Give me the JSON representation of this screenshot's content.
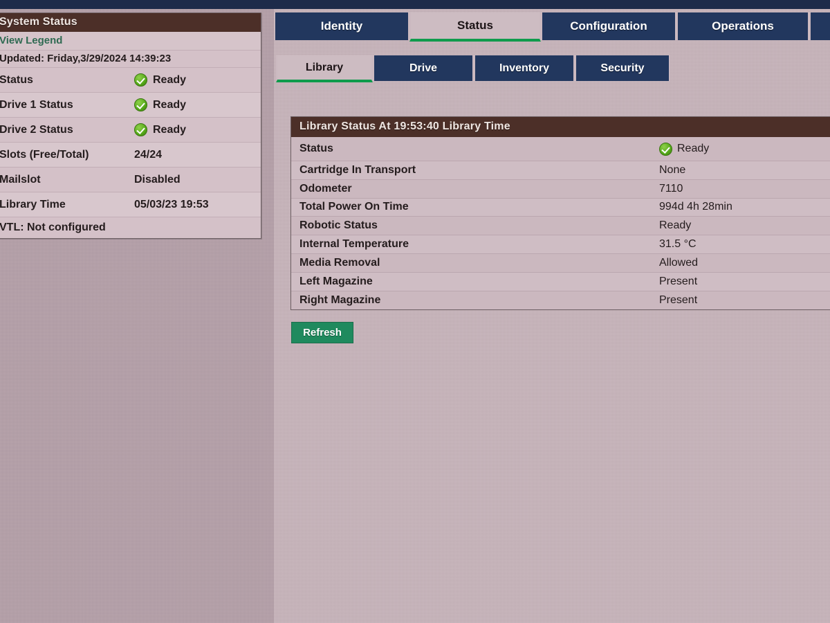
{
  "colors": {
    "navy_strip": "#1d2b4a",
    "tab_inactive": "#22375e",
    "tab_active_underline": "#0f9b4c",
    "panel_header": "#4c2f28",
    "refresh_button": "#1f8a5e",
    "link": "#2f6a52",
    "status_ok": "#55a818",
    "background_left": "#b6a0a9",
    "background_right": "#c7b3ba"
  },
  "sidebar": {
    "title": "System Status",
    "legend_link": "View Legend",
    "updated": "Updated: Friday,3/29/2024 14:39:23",
    "rows": [
      {
        "label": "Status",
        "value": "Ready",
        "icon": "status-ok-icon"
      },
      {
        "label": "Drive 1 Status",
        "value": "Ready",
        "icon": "status-ok-icon"
      },
      {
        "label": "Drive 2 Status",
        "value": "Ready",
        "icon": "status-ok-icon"
      },
      {
        "label": "Slots (Free/Total)",
        "value": "24/24",
        "icon": ""
      },
      {
        "label": "Mailslot",
        "value": "Disabled",
        "icon": ""
      },
      {
        "label": "Library Time",
        "value": "05/03/23 19:53",
        "icon": ""
      }
    ],
    "footer_note": "VTL: Not configured"
  },
  "main_tabs": [
    {
      "label": "Identity",
      "active": false
    },
    {
      "label": "Status",
      "active": true
    },
    {
      "label": "Configuration",
      "active": false
    },
    {
      "label": "Operations",
      "active": false
    }
  ],
  "sub_tabs": [
    {
      "label": "Library",
      "active": true
    },
    {
      "label": "Drive",
      "active": false
    },
    {
      "label": "Inventory",
      "active": false
    },
    {
      "label": "Security",
      "active": false
    }
  ],
  "library_status": {
    "header": "Library Status At 19:53:40 Library Time",
    "rows": [
      {
        "label": "Status",
        "value": "Ready",
        "icon": "status-ok-icon"
      },
      {
        "label": "Cartridge In Transport",
        "value": "None",
        "icon": ""
      },
      {
        "label": "Odometer",
        "value": "7110",
        "icon": ""
      },
      {
        "label": "Total Power On Time",
        "value": "994d 4h 28min",
        "icon": ""
      },
      {
        "label": "Robotic Status",
        "value": "Ready",
        "icon": ""
      },
      {
        "label": "Internal Temperature",
        "value": "31.5 °C",
        "icon": ""
      },
      {
        "label": "Media Removal",
        "value": "Allowed",
        "icon": ""
      },
      {
        "label": "Left Magazine",
        "value": "Present",
        "icon": ""
      },
      {
        "label": "Right Magazine",
        "value": "Present",
        "icon": ""
      }
    ]
  },
  "actions": {
    "refresh_label": "Refresh"
  }
}
